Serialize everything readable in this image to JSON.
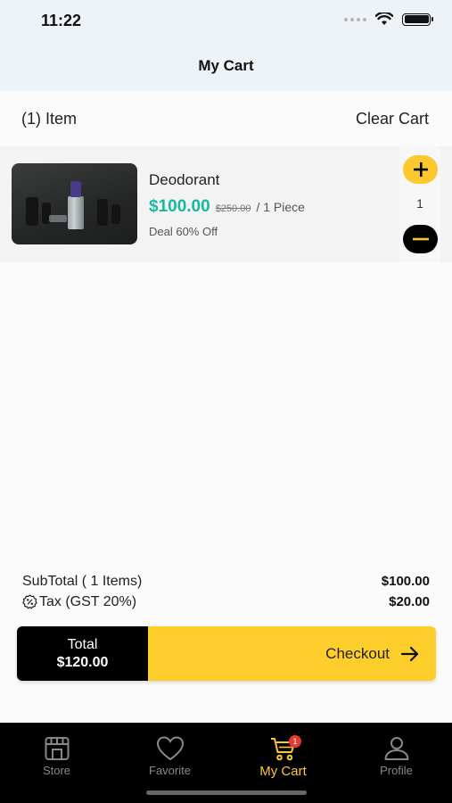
{
  "status_bar": {
    "time": "11:22"
  },
  "header": {
    "title": "My Cart"
  },
  "cart_head": {
    "item_count": "(1) Item",
    "clear_label": "Clear Cart"
  },
  "cart_items": [
    {
      "name": "Deodorant",
      "price": "$100.00",
      "original_price": "$250.00",
      "unit": "/ 1 Piece",
      "deal": "Deal 60% Off",
      "quantity": "1"
    }
  ],
  "summary": {
    "subtotal_label": "SubTotal ( 1 Items)",
    "subtotal_value": "$100.00",
    "tax_label": "Tax (GST 20%)",
    "tax_value": "$20.00"
  },
  "checkout": {
    "total_label": "Total",
    "total_value": "$120.00",
    "checkout_label": "Checkout"
  },
  "tabs": [
    {
      "label": "Store",
      "icon": "store-icon"
    },
    {
      "label": "Favorite",
      "icon": "heart-icon"
    },
    {
      "label": "My Cart",
      "icon": "cart-icon",
      "badge": "1",
      "active": true
    },
    {
      "label": "Profile",
      "icon": "profile-icon"
    }
  ],
  "colors": {
    "accent": "#fdc82e",
    "price": "#17b8a0",
    "badge": "#e53935",
    "tab_bar": "#000000"
  }
}
